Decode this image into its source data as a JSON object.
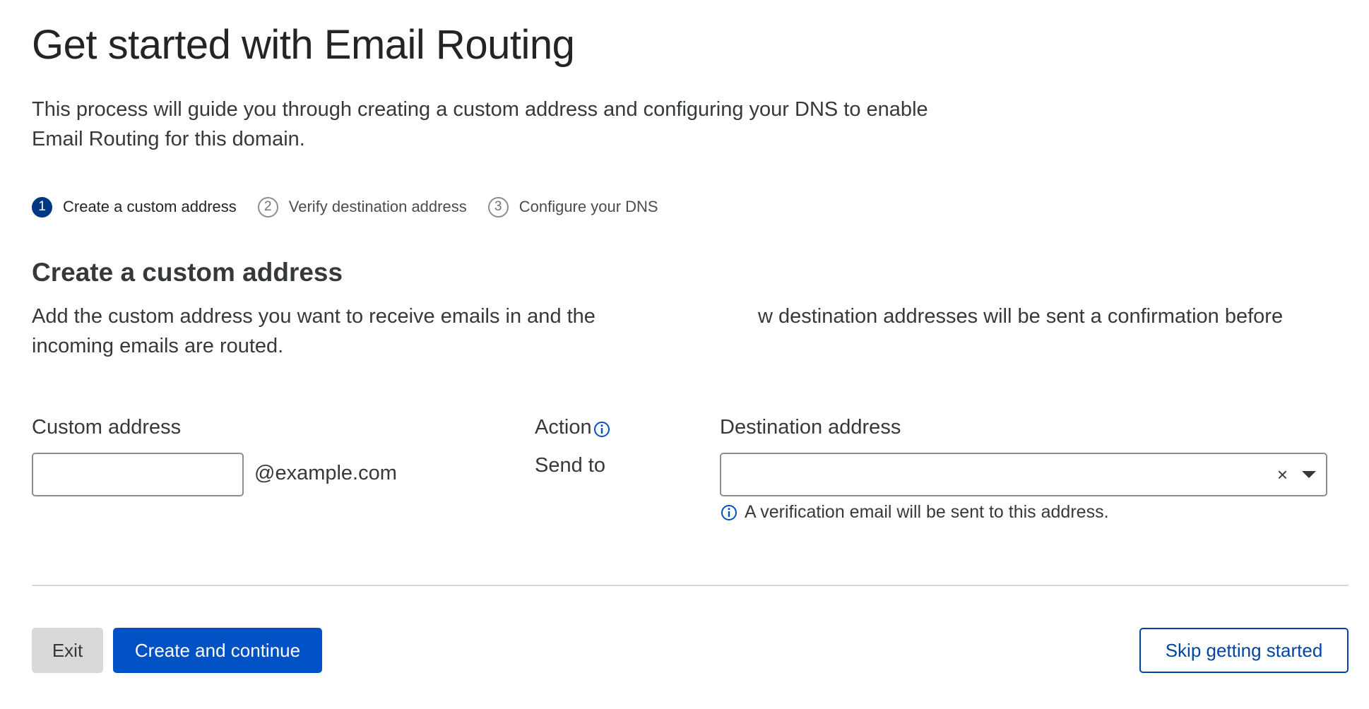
{
  "page": {
    "title": "Get started with Email Routing",
    "intro": "This process will guide you through creating a custom address and configuring your DNS to enable Email Routing for this domain."
  },
  "stepper": {
    "steps": [
      {
        "number": "1",
        "label": "Create a custom address",
        "state": "active"
      },
      {
        "number": "2",
        "label": "Verify destination address",
        "state": "pending"
      },
      {
        "number": "3",
        "label": "Configure your DNS",
        "state": "pending"
      }
    ]
  },
  "section": {
    "title": "Create a custom address",
    "description_part1": "Add the custom address you want to receive emails in and the",
    "description_part2": "w destination addresses will be sent a confirmation before incoming emails are routed."
  },
  "form": {
    "custom_address": {
      "label": "Custom address",
      "value": "",
      "placeholder": "",
      "domain_suffix": "@example.com"
    },
    "action": {
      "label": "Action",
      "info_icon": "info-icon",
      "value": "Send to"
    },
    "destination": {
      "label": "Destination address",
      "value": "",
      "clear_glyph": "×",
      "dropdown_icon": "chevron-down-icon",
      "helper_text": "A verification email will be sent to this address.",
      "helper_icon": "info-icon"
    }
  },
  "footer": {
    "exit_label": "Exit",
    "primary_label": "Create and continue",
    "skip_label": "Skip getting started"
  },
  "colors": {
    "accent": "#0051c3",
    "step_active": "#003682",
    "link": "#0045a6",
    "exit_bg": "#d9d9d9"
  }
}
